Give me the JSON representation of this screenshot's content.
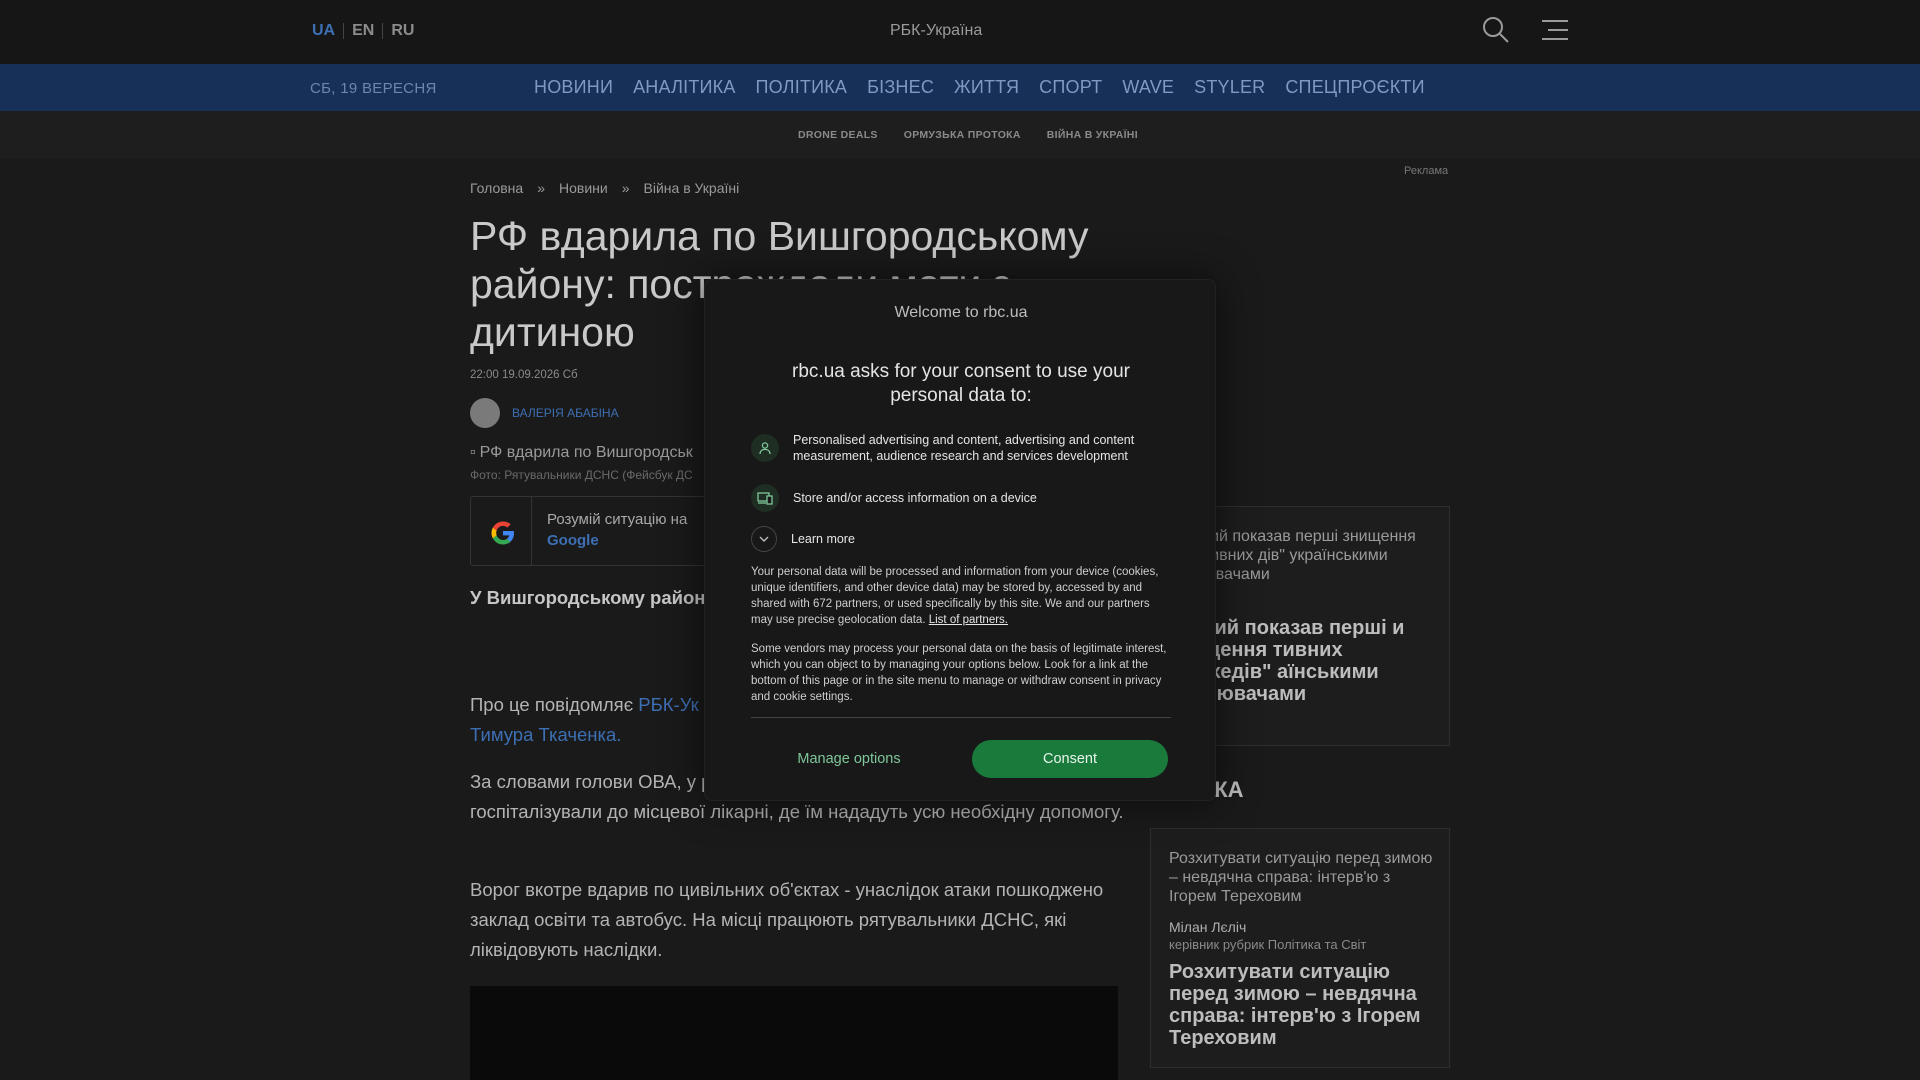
{
  "header": {
    "languages": [
      {
        "label": "UA",
        "active": true
      },
      {
        "label": "EN",
        "active": false
      },
      {
        "label": "RU",
        "active": false
      }
    ],
    "logo_alt": "РБК-Україна",
    "icons": {
      "search": "search-icon",
      "menu": "hamburger-menu-icon"
    }
  },
  "nav": {
    "date": "СБ, 19 ВЕРЕСНЯ",
    "items": [
      "НОВИНИ",
      "АНАЛІТИКА",
      "ПОЛІТИКА",
      "БІЗНЕС",
      "ЖИТТЯ",
      "СПОРТ",
      "WAVE",
      "STYLER",
      "СПЕЦПРОЄКТИ"
    ]
  },
  "subnav": {
    "items": [
      "DRONE DEALS",
      "ОРМУЗЬКА ПРОТОКА",
      "ВІЙНА В УКРАЇНІ"
    ]
  },
  "ad_label": "Реклама",
  "article": {
    "breadcrumb": [
      "Головна",
      "»",
      "Новини",
      "»",
      "Війна в Україні"
    ],
    "title": "РФ вдарила по Вишгородському району: постраждали мати з дитиною",
    "date": "22:00 19.09.2026 Сб",
    "author": "ВАЛЕРІЯ АБАБІНА",
    "photo_alt": "РФ вдарила по Вишгородськ",
    "photo_caption": "Фото: Рятувальники ДСНС (Фейсбук ДС",
    "google_text": "Розумій ситуацію на",
    "google_link": "Google",
    "lead": "У Вишгородському районі постраждали двоє людей місцевої лікарні.",
    "para1_text": "Про це повідомляє ",
    "para1_link1": "РБК-Ук",
    "para1_link2": "Тимура Ткаченка.",
    "para2": "За словами голови ОВА, у районі постраждали мати та дитина. Обох госпіталізували до місцевої лікарні, де їм нададуть усю необхідну допомогу.",
    "para3": "Ворог вкотре вдарив по цивільних об'єктах - унаслідок атаки пошкоджено заклад освіти та автобус. На місці працюють рятувальники ДСНС, які ліквідовують наслідки."
  },
  "sidebar": {
    "heading1": "НИ",
    "card1": {
      "img_alt": "енський показав перші знищення реактивних дів\" українськими хоплювачами",
      "headline": "нський показав перші и знищення тивних \"Шахедів\" аїнськими хоплювачами"
    },
    "heading2": "ТИКА",
    "card2": {
      "img_alt": "Розхитувати ситуацію перед зимою – невдячна справа: інтерв'ю з Ігорем Тереховим",
      "author": "Мілан Лєліч",
      "role": "керівник рубрик Політика та Світ",
      "headline": "Розхитувати ситуацію перед зимою – невдячна справа: інтерв'ю з Ігорем Тереховим"
    }
  },
  "consent": {
    "logo_alt": "Welcome to rbc.ua",
    "title": "rbc.ua asks for your consent to use your personal data to:",
    "purposes": [
      {
        "icon": "person-icon",
        "text": "Personalised advertising and content, advertising and content measurement, audience research and services development"
      },
      {
        "icon": "device-icon",
        "text": "Store and/or access information on a device"
      }
    ],
    "learn_more": "Learn more",
    "body1": "Your personal data will be processed and information from your device (cookies, unique identifiers, and other device data) may be stored by, accessed by and shared with 672 partners, or used specifically by this site. We and our partners may use precise geolocation data.",
    "partners_link": "List of partners.",
    "body2": "Some vendors may process your personal data on the basis of legitimate interest, which you can object to by managing your options below. Look for a link at the bottom of this page or in the site menu to manage or withdraw consent in privacy and cookie settings.",
    "manage_label": "Manage options",
    "consent_label": "Consent",
    "accent": "#1a7a3c"
  }
}
